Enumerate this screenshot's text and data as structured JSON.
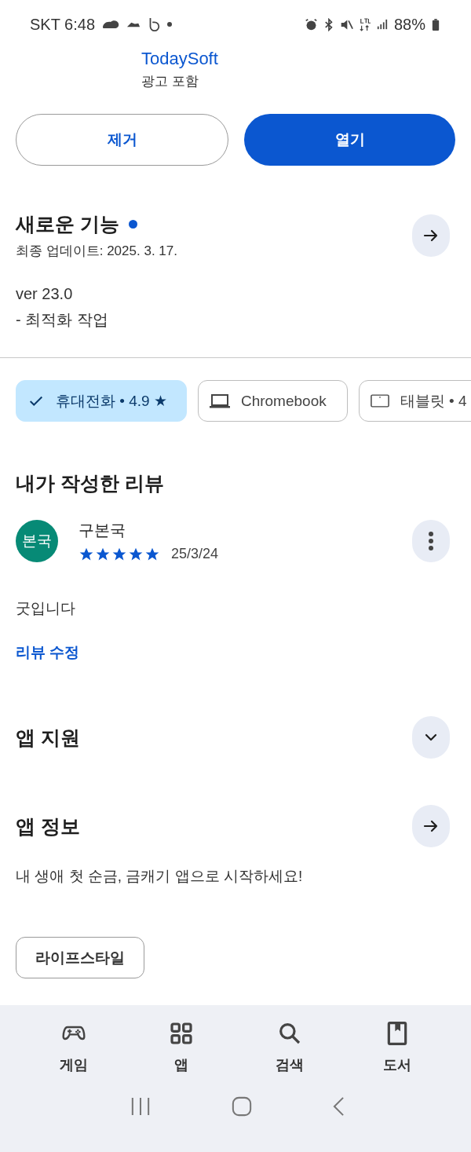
{
  "status_bar": {
    "carrier_time": "SKT 6:48",
    "battery": "88%"
  },
  "developer": {
    "name": "TodaySoft",
    "note": "광고 포함"
  },
  "actions": [
    {
      "label": "제거",
      "kind": "outline"
    },
    {
      "label": "열기",
      "kind": "filled"
    }
  ],
  "whats_new": {
    "title": "새로운 기능",
    "new_dot": true,
    "updated": "최종 업데이트: 2025. 3. 17.",
    "lines": [
      "ver 23.0",
      "- 최적화 작업"
    ]
  },
  "device_chips": [
    {
      "label": "휴대전화 • 4.9 ★",
      "selected": true
    },
    {
      "label": "Chromebook",
      "kind": "laptop",
      "selected": false
    },
    {
      "label": "태블릿 • 4",
      "kind": "tablet",
      "selected": false
    }
  ],
  "my_review": {
    "title": "내가 작성한 리뷰",
    "avatar": "본국",
    "author": "구본국",
    "stars": 5,
    "date": "25/3/24",
    "text": "굿입니다",
    "edit_link": "리뷰 수정"
  },
  "sections": [
    {
      "title": "앱 지원",
      "kind": "expand",
      "expanded": false
    },
    {
      "title": "앱 정보",
      "kind": "arrow"
    }
  ],
  "app_info": {
    "description": "내 생애 첫 순금, 금캐기 앱으로 시작하세요!",
    "tag": "라이프스타일"
  },
  "bottom_nav": [
    {
      "label": "게임",
      "kind": "games"
    },
    {
      "label": "앱",
      "kind": "apps"
    },
    {
      "label": "검색",
      "kind": "search"
    },
    {
      "label": "도서",
      "kind": "books"
    }
  ]
}
